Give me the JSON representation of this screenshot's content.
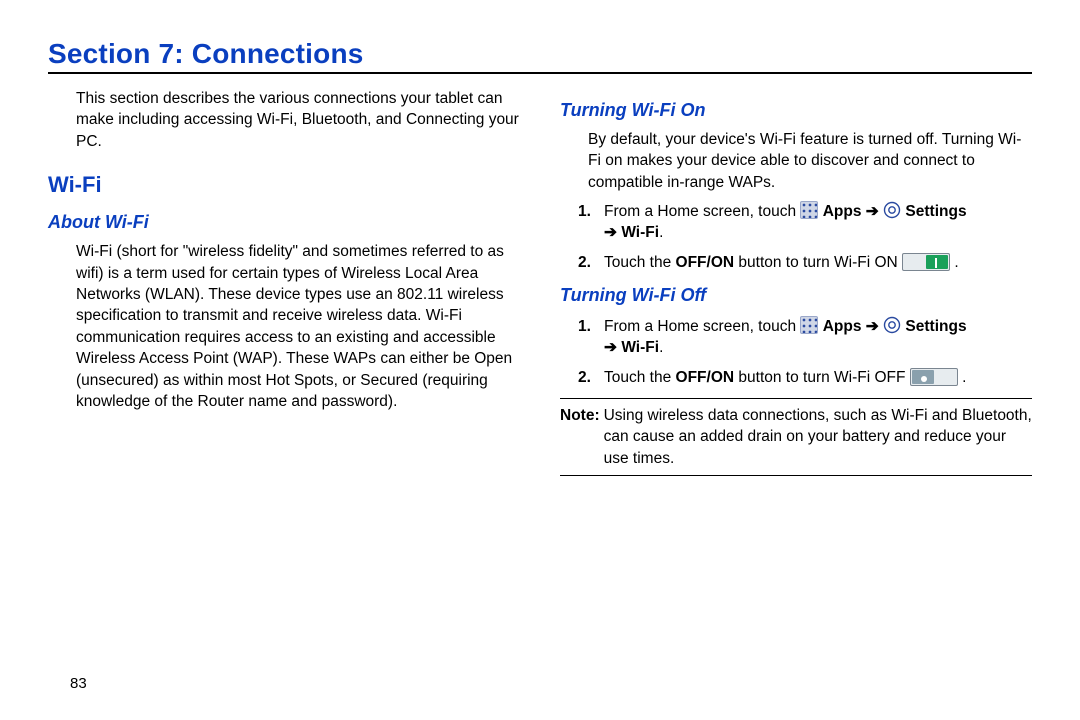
{
  "section_title": "Section 7: Connections",
  "page_number": "83",
  "left": {
    "intro": "This section describes the various connections your tablet can make including accessing Wi-Fi, Bluetooth, and Connecting your PC.",
    "h2_wifi": "Wi-Fi",
    "h3_about": "About Wi-Fi",
    "about_body": "Wi-Fi (short for \"wireless fidelity\" and sometimes referred to as wifi) is a term used for certain types of Wireless Local Area Networks (WLAN). These device types use an 802.11 wireless specification to transmit and receive wireless data. Wi-Fi communication requires access to an existing and accessible Wireless Access Point (WAP). These WAPs can either be Open (unsecured) as within most Hot Spots, or Secured (requiring knowledge of the Router name and password)."
  },
  "right": {
    "h3_on": "Turning Wi-Fi On",
    "on_intro": "By default, your device's Wi-Fi feature is turned off. Turning Wi-Fi on makes your device able to discover and connect to compatible in-range WAPs.",
    "on_steps": {
      "s1_a": "From a Home screen, touch ",
      "s1_apps": " Apps ",
      "s1_arrow": "➔",
      "s1_settings": " Settings ",
      "s1_wifi": " Wi-Fi",
      "s2_a": "Touch the ",
      "s2_b": "OFF/ON",
      "s2_c": " button to turn Wi-Fi ON "
    },
    "h3_off": "Turning Wi-Fi Off",
    "off_steps": {
      "s1_a": "From a Home screen, touch ",
      "s1_apps": " Apps ",
      "s1_arrow": "➔",
      "s1_settings": " Settings ",
      "s1_wifi": " Wi-Fi",
      "s2_a": "Touch the ",
      "s2_b": "OFF/ON",
      "s2_c": " button to turn Wi-Fi OFF "
    },
    "note_label": "Note:",
    "note_text": "Using wireless data connections, such as Wi-Fi and Bluetooth, can cause an added drain on your battery and reduce your use times."
  },
  "list_numbers": {
    "n1": "1.",
    "n2": "2."
  },
  "period": "."
}
